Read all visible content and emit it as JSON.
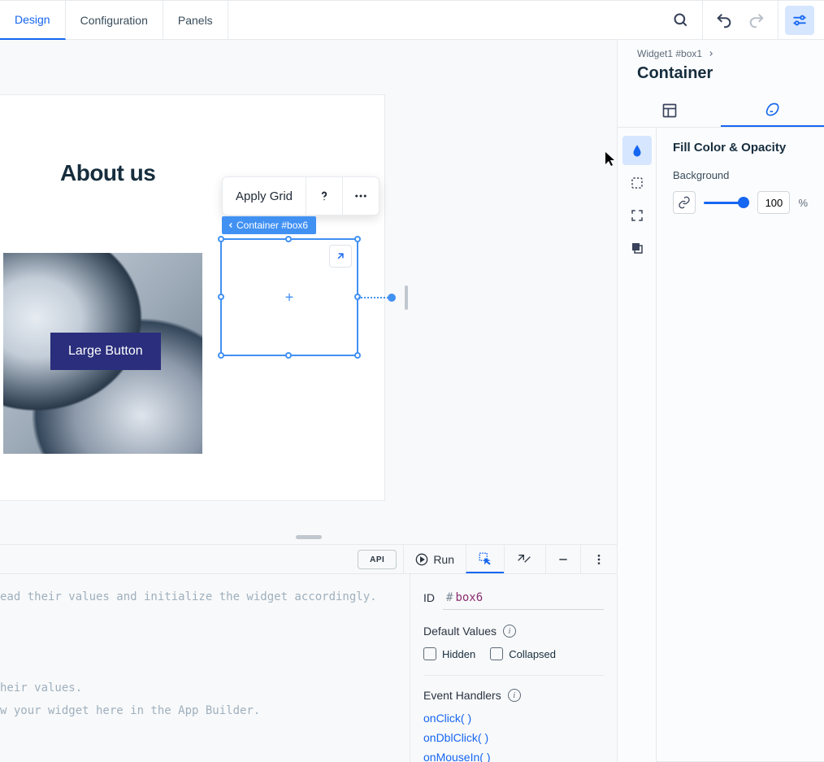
{
  "topbar": {
    "tabs": [
      "Design",
      "Configuration",
      "Panels"
    ],
    "active_tab_index": 0
  },
  "canvas": {
    "heading": "About us",
    "large_button_label": "Large Button",
    "float_toolbar": {
      "apply_grid": "Apply Grid"
    },
    "selected_tag": "Container #box6"
  },
  "inspector": {
    "breadcrumb": "Widget1 #box1",
    "title": "Container",
    "section_title": "Fill Color & Opacity",
    "background_label": "Background",
    "opacity_value": "100",
    "opacity_unit": "%"
  },
  "bottom_bar": {
    "run_label": "Run",
    "api_label": "API"
  },
  "props": {
    "id_label": "ID",
    "id_value": "box6",
    "defaults_label": "Default Values",
    "hidden_label": "Hidden",
    "collapsed_label": "Collapsed",
    "events_label": "Event Handlers",
    "events": [
      "onClick( )",
      "onDblClick( )",
      "onMouseIn( )"
    ]
  },
  "code": {
    "line1": "ead their values and initialize the widget accordingly.",
    "line2": "heir values.",
    "line3": "w your widget here in the App Builder."
  }
}
